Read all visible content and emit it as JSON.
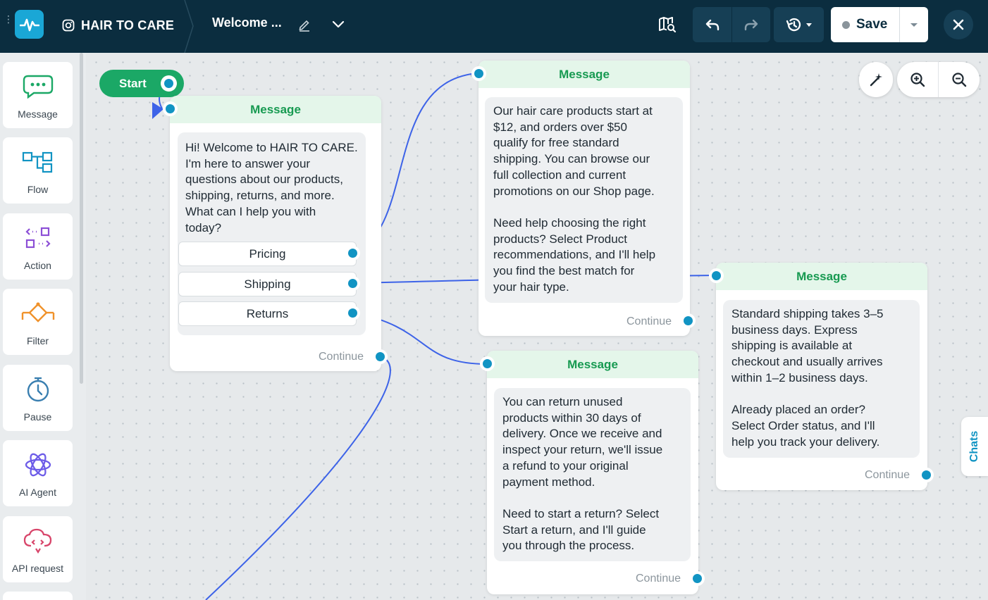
{
  "topbar": {
    "brand": "HAIR TO CARE",
    "flow_title": "Welcome ...",
    "save_label": "Save"
  },
  "sidebar": {
    "items": [
      {
        "label": "Message",
        "icon": "chat-bubble-icon"
      },
      {
        "label": "Flow",
        "icon": "flow-icon"
      },
      {
        "label": "Action",
        "icon": "action-icon"
      },
      {
        "label": "Filter",
        "icon": "filter-icon"
      },
      {
        "label": "Pause",
        "icon": "stopwatch-icon"
      },
      {
        "label": "AI Agent",
        "icon": "ai-agent-icon"
      },
      {
        "label": "API request",
        "icon": "cloud-api-icon"
      }
    ]
  },
  "canvas": {
    "start_label": "Start",
    "chats_label": "Chats",
    "nodes": [
      {
        "title": "Message",
        "text": "Hi! Welcome to HAIR TO CARE.\nI'm here to answer your\nquestions about our products,\nshipping, returns, and more.\nWhat can I help you with\ntoday?",
        "buttons": [
          "Pricing",
          "Shipping",
          "Returns"
        ],
        "continue": "Continue"
      },
      {
        "title": "Message",
        "text": "Our hair care products start at\n$12, and orders over $50\nqualify for free standard\nshipping. You can browse our\nfull collection and current\npromotions on our Shop page.\n\nNeed help choosing the right\nproducts? Select Product\nrecommendations, and I'll help\nyou find the best match for\nyour hair type.",
        "continue": "Continue"
      },
      {
        "title": "Message",
        "text": "Standard shipping takes 3–5\nbusiness days. Express\nshipping is available at\ncheckout and usually arrives\nwithin 1–2 business days.\n\nAlready placed an order?\nSelect Order status, and I'll\nhelp you track your delivery.",
        "continue": "Continue"
      },
      {
        "title": "Message",
        "text": "You can return unused\nproducts within 30 days of\ndelivery. Once we receive and\ninspect your return, we'll issue\na refund to your original\npayment method.\n\nNeed to start a return? Select\nStart a return, and I'll guide\nyou through the process.",
        "continue": "Continue"
      }
    ]
  },
  "colors": {
    "topbar": "#0b2d3f",
    "accent_blue": "#1194c3",
    "start_green": "#1ba866",
    "node_header_bg": "#e4f6ea",
    "node_header_text": "#179a51",
    "edge": "#3d63e8"
  }
}
